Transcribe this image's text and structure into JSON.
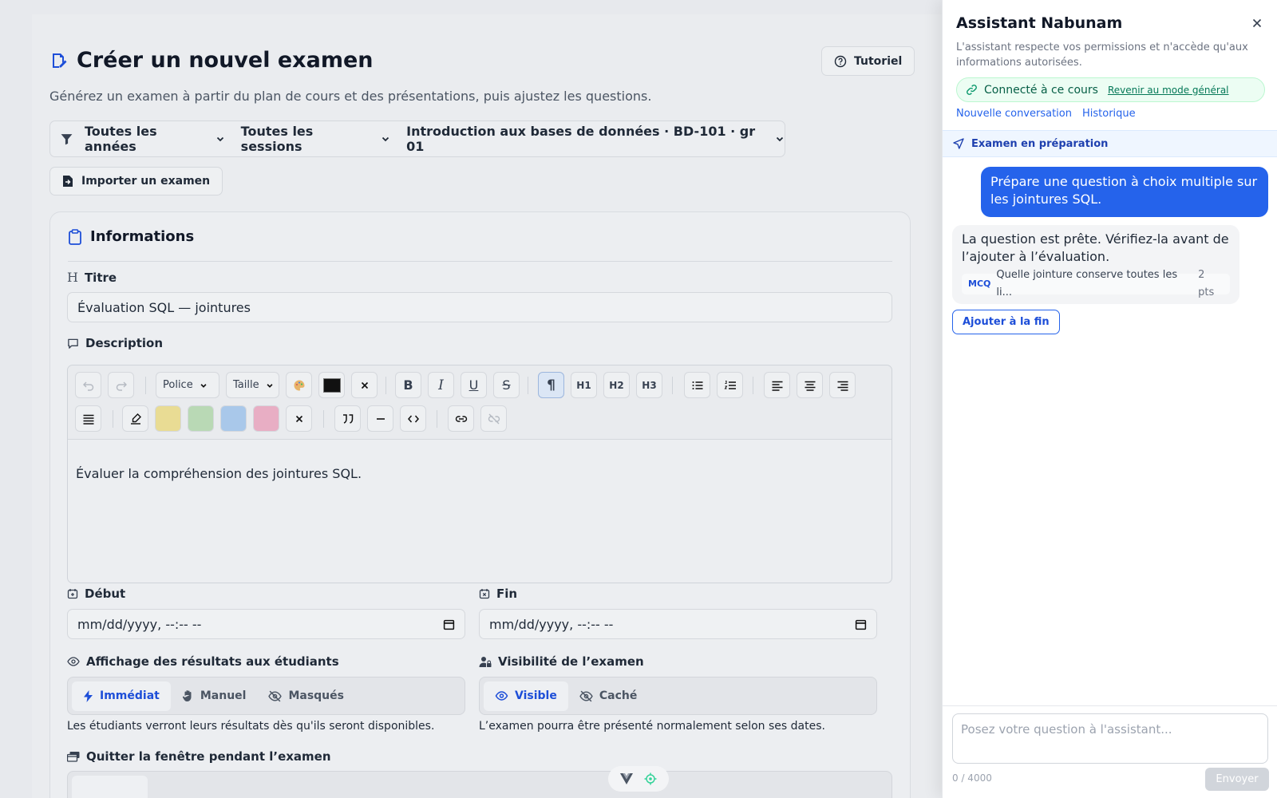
{
  "page": {
    "title": "Créer un nouvel examen",
    "subtitle": "Générez un examen à partir du plan de cours et des présentations, puis ajustez les questions.",
    "tutorial_label": "Tutoriel"
  },
  "filters": {
    "year": "Toutes les années",
    "session": "Toutes les sessions",
    "course": "Introduction aux bases de données · BD-101 · gr 01"
  },
  "import_label": "Importer un examen",
  "info_card": {
    "heading": "Informations",
    "title_label": "Titre",
    "title_value": "Évaluation SQL — jointures",
    "description_label": "Description",
    "font_select": "Police",
    "size_select": "Taille",
    "heading_buttons": [
      "H1",
      "H2",
      "H3"
    ],
    "description_text": "Évaluer la compréhension des jointures SQL.",
    "highlight_colors": [
      "#e9dc94",
      "#b9d9b5",
      "#a9c8ea",
      "#e8aec4"
    ],
    "text_color": "#111111",
    "start_label": "Début",
    "start_value": "mm/dd/yyyy, --:-- --",
    "end_label": "Fin",
    "end_value": "mm/dd/yyyy, --:-- --",
    "results_label": "Affichage des résultats aux étudiants",
    "results_options": [
      "Immédiat",
      "Manuel",
      "Masqués"
    ],
    "results_selected": "Immédiat",
    "results_help": "Les étudiants verront leurs résultats dès qu'ils seront disponibles.",
    "visibility_label": "Visibilité de l’examen",
    "visibility_options": [
      "Visible",
      "Caché"
    ],
    "visibility_selected": "Visible",
    "visibility_help": "L’examen pourra être présenté normalement selon ses dates.",
    "leave_window_label": "Quitter la fenêtre pendant l’examen"
  },
  "assistant": {
    "title": "Assistant Nabunam",
    "description": "L'assistant respecte vos permissions et n'accède qu'aux informations autorisées.",
    "connected_text": "Connecté à ce cours",
    "connected_link": "Revenir au mode général",
    "new_conversation": "Nouvelle conversation",
    "history": "Historique",
    "status": "Examen en préparation",
    "user_message": "Prépare une question à choix multiple sur les jointures SQL.",
    "bot_message": "La question est prête. Vérifiez-la avant de l’ajouter à l’évaluation.",
    "mcq_tag": "MCQ",
    "mcq_text": "Quelle jointure conserve toutes les li...",
    "mcq_points": "2 pts",
    "add_button": "Ajouter à la fin",
    "input_placeholder": "Posez votre question à l'assistant...",
    "counter": "0 / 4000",
    "send_label": "Envoyer"
  },
  "colors": {
    "accent": "#2563eb",
    "connected_bg": "#ecfdf3"
  }
}
